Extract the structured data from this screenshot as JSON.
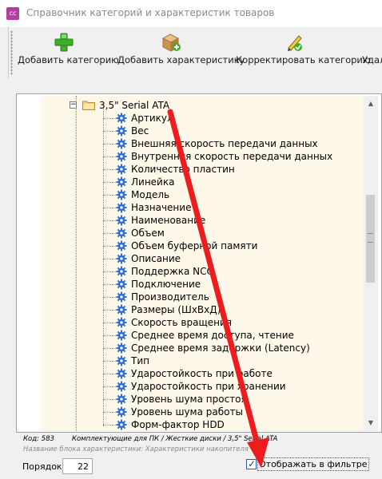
{
  "window": {
    "title": "Справочник категорий и характеристик товаров",
    "app_icon_text": "cc"
  },
  "toolbar": {
    "add_category": "Добавить категорию",
    "add_characteristic": "Добавить характеристику",
    "edit_category": "Корректировать категорию",
    "delete_partial": "Удал"
  },
  "tree": {
    "parent": "3,5\" Serial ATA",
    "children": [
      "Артикул",
      "Вес",
      "Внешняя скорость передачи данных",
      "Внутренняя скорость передачи данных",
      "Количество пластин",
      "Линейка",
      "Модель",
      "Назначение",
      "Наименование",
      "Объем",
      "Объем буферной памяти",
      "Описание",
      "Поддержка NCQ",
      "Подключение",
      "Производитель",
      "Размеры (ШхВхД)",
      "Скорость вращения",
      "Среднее время доступа, чтение",
      "Среднее время задержки (Latency)",
      "Тип",
      "Ударостойкость при работе",
      "Ударостойкость при хранении",
      "Уровень шума простоя",
      "Уровень шума работы",
      "Форм-фактор HDD"
    ]
  },
  "info": {
    "code": "Код: 583",
    "path": "Комплектующие для ПК / Жесткие диски / 3,5\" Serial ATA",
    "block_name": "Название блока характеристики: Характеристики накопителя"
  },
  "order": {
    "label": "Порядок:",
    "value": "22"
  },
  "filter_checkbox": {
    "label": "Отображать в фильтре",
    "checked": true
  },
  "colors": {
    "tree_background": "#fdf8ea",
    "annotation_arrow": "#ee1c1c",
    "gear_blue": "#2f6fd0"
  }
}
